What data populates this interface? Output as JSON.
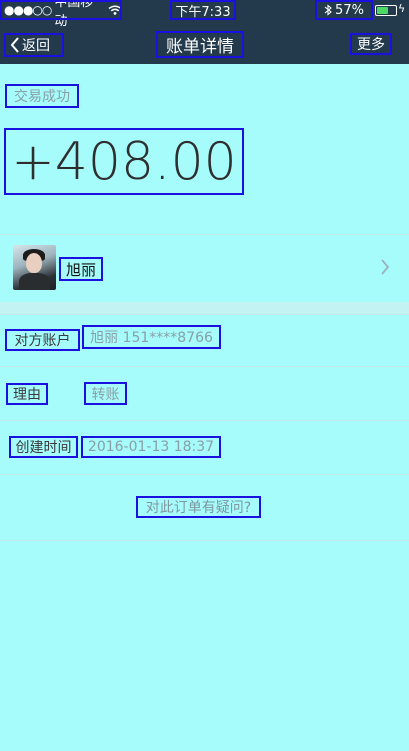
{
  "status_bar": {
    "signal_dots": "●●●○○",
    "carrier": "中国移动",
    "time": "下午7:33",
    "battery_percent": "57%",
    "battery_level": 0.57
  },
  "nav": {
    "back_label": "返回",
    "title": "账单详情",
    "more_label": "更多"
  },
  "transaction": {
    "status": "交易成功",
    "amount": "+408.00"
  },
  "counterparty": {
    "name": "旭丽"
  },
  "details": {
    "account_label": "对方账户",
    "account_value": "旭丽 151****8766",
    "reason_label": "理由",
    "reason_value": "转账",
    "created_label": "创建时间",
    "created_value": "2016-01-13 18:37"
  },
  "question_link": "对此订单有疑问?",
  "colors": {
    "nav_background": "#223a4c",
    "page_background": "#a6fbfb",
    "annotation_box": "#1a10e0",
    "battery_fill": "#4cd964"
  }
}
